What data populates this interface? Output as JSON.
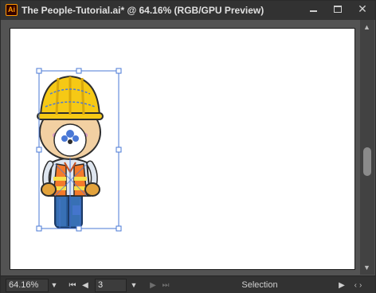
{
  "window": {
    "title": "The People-Tutorial.ai* @ 64.16% (RGB/GPU Preview)",
    "app_icon_text": "Ai",
    "accent_color": "#ff9a00"
  },
  "controls": {
    "minimize_icon": "minimize-icon",
    "maximize_icon": "maximize-icon",
    "close_icon": "close-icon",
    "close_glyph": "✕"
  },
  "statusbar": {
    "zoom_value": "64.16%",
    "artboard_number": "3",
    "tool_label": "Selection"
  },
  "artwork": {
    "subject": "construction-worker-illustration",
    "selection_color": "#4a78d6",
    "helmet_color": "#f6c915",
    "vest_color": "#f47a2b",
    "stripe_color": "#f7e04a",
    "pants_color": "#2a5d9c",
    "skin_color": "#f2d0a2"
  }
}
